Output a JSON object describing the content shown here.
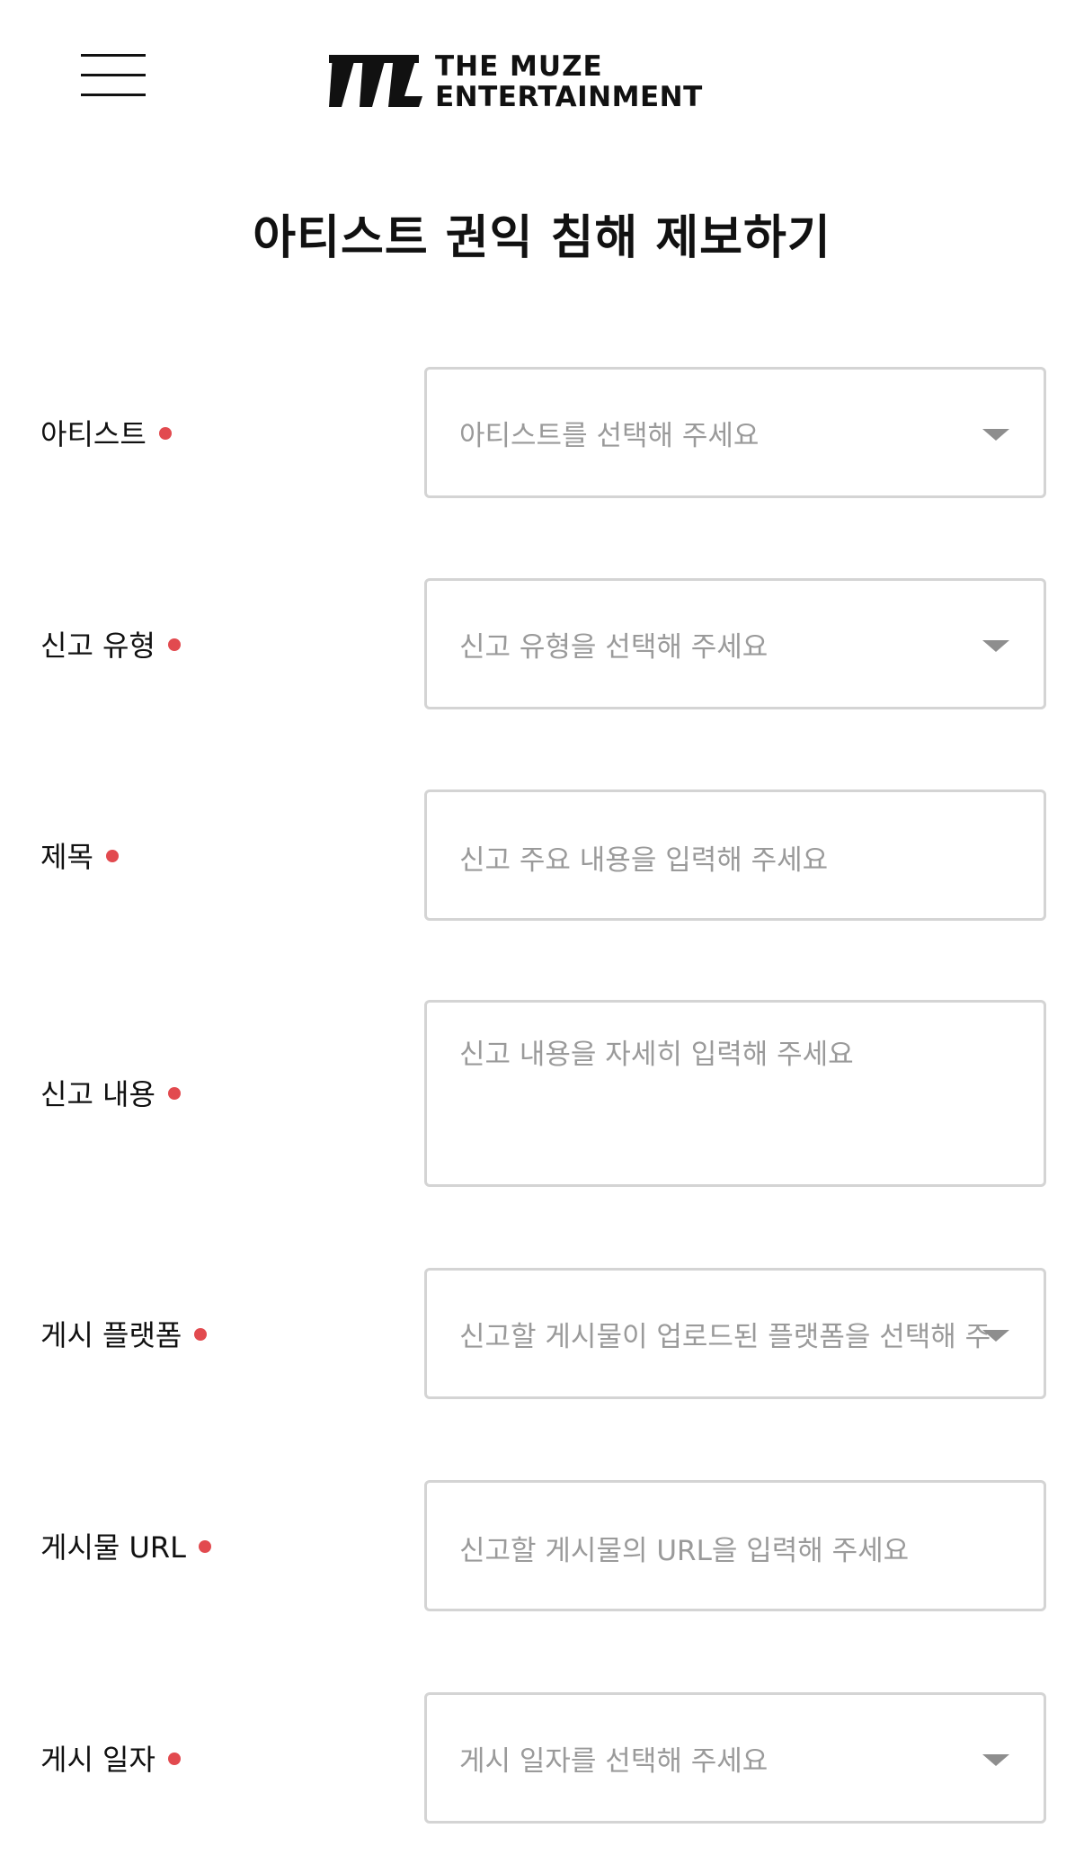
{
  "header": {
    "menu_icon": "hamburger-menu-icon",
    "logo_line1": "THE MUZE",
    "logo_line2": "ENTERTAINMENT"
  },
  "title": "아티스트 권익 침해 제보하기",
  "form": {
    "fields": [
      {
        "label": "아티스트",
        "placeholder": "아티스트를 선택해 주세요",
        "type": "select",
        "required": true
      },
      {
        "label": "신고 유형",
        "placeholder": "신고 유형을 선택해 주세요",
        "type": "select",
        "required": true
      },
      {
        "label": "제목",
        "placeholder": "신고 주요 내용을 입력해 주세요",
        "type": "text",
        "required": true
      },
      {
        "label": "신고 내용",
        "placeholder": "신고 내용을 자세히 입력해 주세요",
        "type": "textarea",
        "required": true
      },
      {
        "label": "게시 플랫폼",
        "placeholder": "신고할 게시물이 업로드된 플랫폼을 선택해 주",
        "type": "select",
        "required": true
      },
      {
        "label": "게시물 URL",
        "placeholder": "신고할 게시물의 URL을 입력해 주세요",
        "type": "text",
        "required": true
      },
      {
        "label": "게시 일자",
        "placeholder": "게시 일자를 선택해 주세요",
        "type": "select",
        "required": true
      }
    ]
  },
  "colors": {
    "required_dot": "#e24a4f",
    "border": "#d4d4d4",
    "placeholder_text": "#9a9a9a"
  }
}
